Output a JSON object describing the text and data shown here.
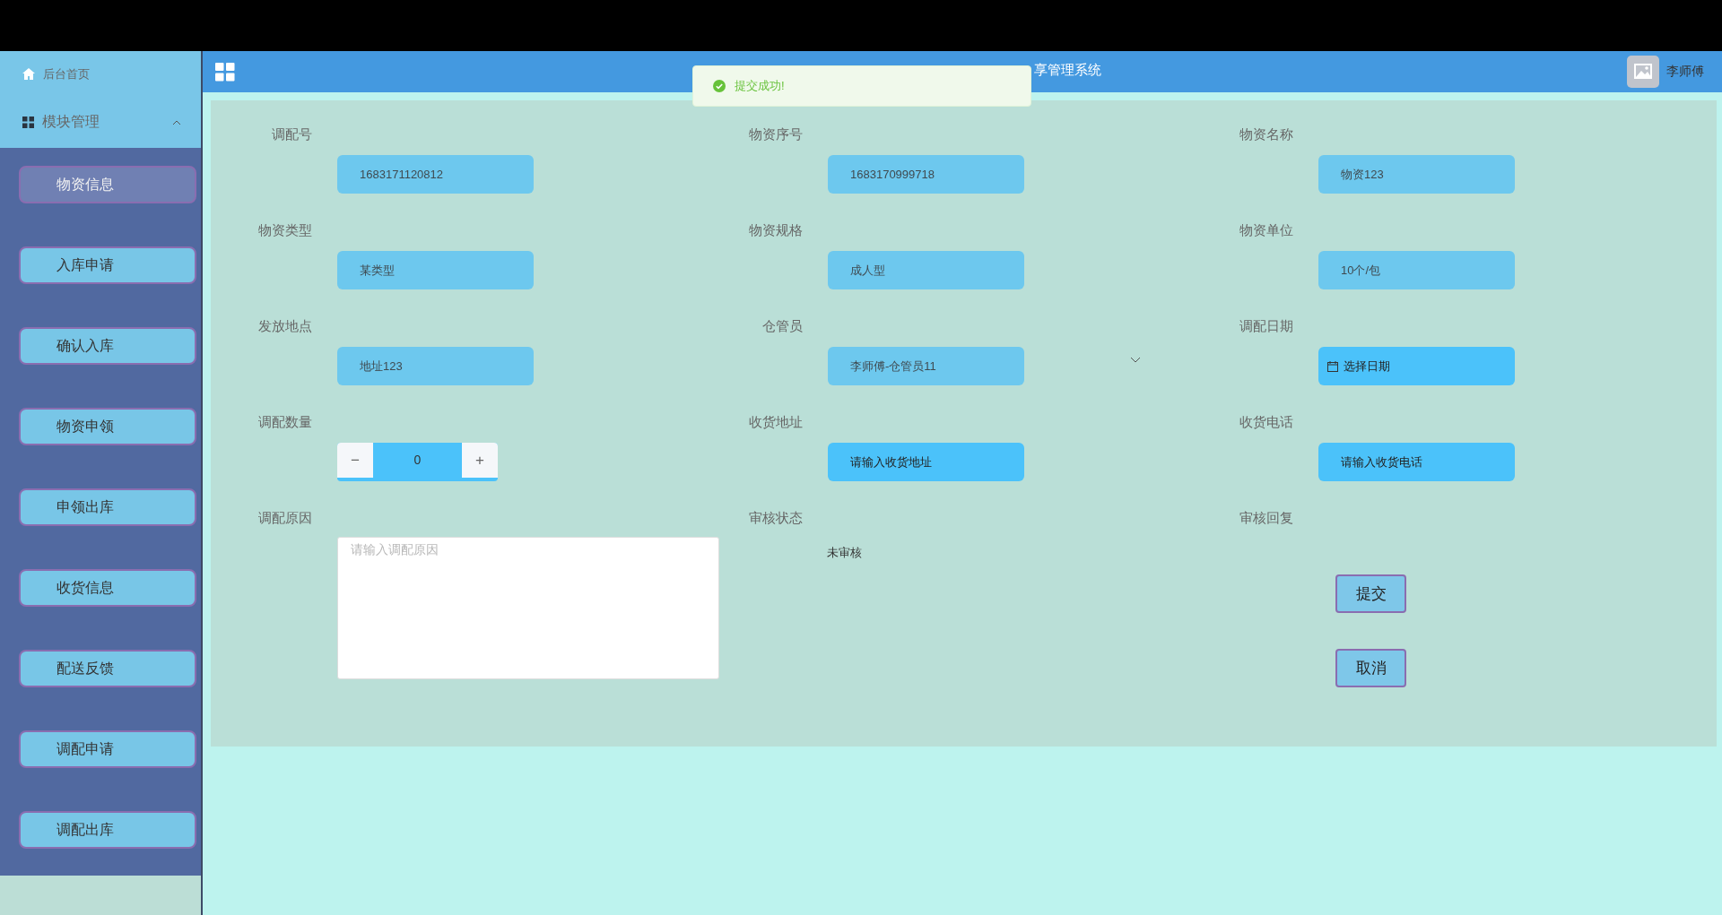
{
  "sidebar": {
    "home": {
      "label": "后台首页"
    },
    "group": {
      "label": "模块管理",
      "expanded": true
    },
    "items": [
      {
        "label": "物资信息",
        "selected": true
      },
      {
        "label": "入库申请",
        "selected": false
      },
      {
        "label": "确认入库",
        "selected": false
      },
      {
        "label": "物资申领",
        "selected": false
      },
      {
        "label": "申领出库",
        "selected": false
      },
      {
        "label": "收货信息",
        "selected": false
      },
      {
        "label": "配送反馈",
        "selected": false
      },
      {
        "label": "调配申请",
        "selected": false
      },
      {
        "label": "调配出库",
        "selected": false
      }
    ]
  },
  "header": {
    "title": "享管理系统",
    "user": "李师傅"
  },
  "toast": {
    "kind": "success",
    "message": "提交成功!"
  },
  "form": {
    "fields": [
      {
        "label": "调配号",
        "kind": "readonly",
        "value": "1683171120812"
      },
      {
        "label": "物资序号",
        "kind": "readonly",
        "value": "1683170999718"
      },
      {
        "label": "物资名称",
        "kind": "readonly",
        "value": "物资123"
      },
      {
        "label": "物资类型",
        "kind": "readonly",
        "value": "某类型"
      },
      {
        "label": "物资规格",
        "kind": "readonly",
        "value": "成人型"
      },
      {
        "label": "物资单位",
        "kind": "readonly",
        "value": "10个/包"
      },
      {
        "label": "发放地点",
        "kind": "readonly",
        "value": "地址123"
      },
      {
        "label": "仓管员",
        "kind": "select",
        "value": "李师傅-仓管员11"
      },
      {
        "label": "调配日期",
        "kind": "date",
        "placeholder": "选择日期"
      },
      {
        "label": "调配数量",
        "kind": "number",
        "value": "0",
        "minus": "−",
        "plus": "+"
      },
      {
        "label": "收货地址",
        "kind": "input",
        "placeholder": "请输入收货地址"
      },
      {
        "label": "收货电话",
        "kind": "input",
        "placeholder": "请输入收货电话"
      },
      {
        "label": "调配原因",
        "kind": "textarea",
        "placeholder": "请输入调配原因"
      },
      {
        "label": "审核状态",
        "kind": "text",
        "value": "未审核"
      },
      {
        "label": "审核回复",
        "kind": "actions",
        "buttons": [
          "提交",
          "取消"
        ]
      }
    ]
  }
}
